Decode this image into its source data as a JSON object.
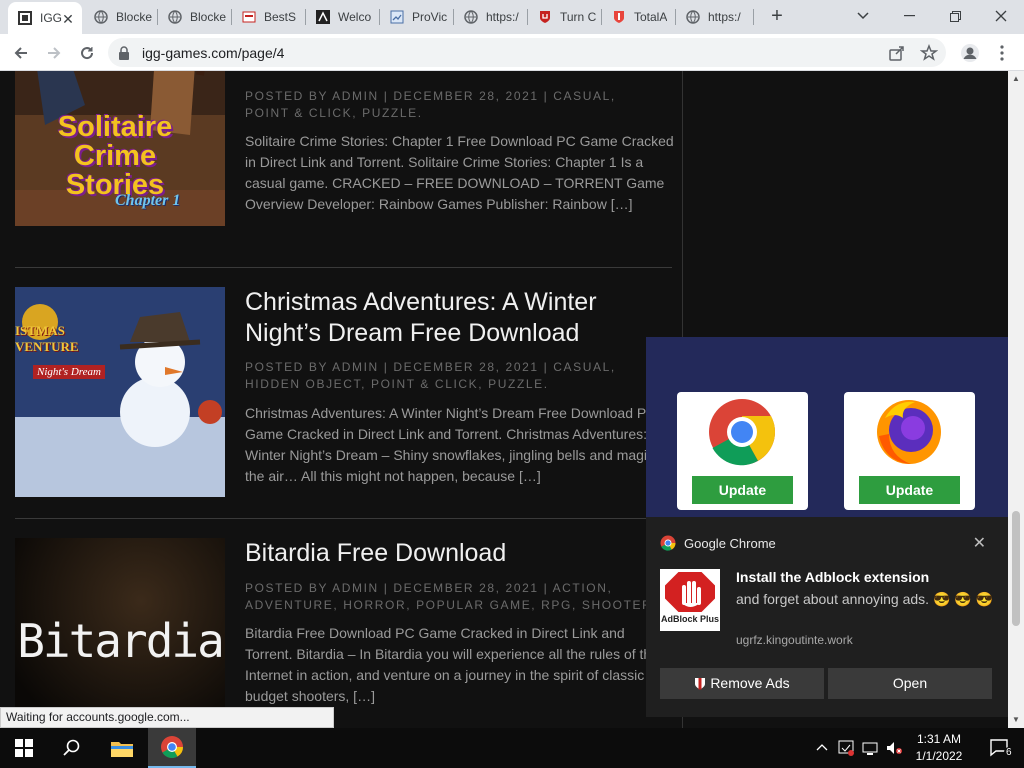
{
  "browser": {
    "tabs": [
      {
        "title": "IGG",
        "active": true
      },
      {
        "title": "Blocke"
      },
      {
        "title": "Blocke"
      },
      {
        "title": "BestS"
      },
      {
        "title": "Welco"
      },
      {
        "title": "ProVic"
      },
      {
        "title": "https:/"
      },
      {
        "title": "Turn C"
      },
      {
        "title": "TotalA"
      },
      {
        "title": "https:/"
      }
    ],
    "url": "igg-games.com/page/4",
    "status_text": "Waiting for accounts.google.com..."
  },
  "posts": [
    {
      "thumb_title": "Solitaire Crime Stories",
      "thumb_subtitle": "Chapter 1",
      "meta": "POSTED BY ADMIN | DECEMBER 28, 2021 | CASUAL, POINT & CLICK, PUZZLE.",
      "excerpt": "Solitaire Crime Stories: Chapter 1 Free Download PC Game Cracked in Direct Link and Torrent. Solitaire Crime Stories: Chapter 1 Is a casual game. CRACKED – FREE DOWNLOAD – TORRENT Game Overview   Developer: Rainbow Games Publisher: Rainbow […]"
    },
    {
      "title": "Christmas Adventures: A Winter Night’s Dream Free Download",
      "thumb_title": "ISTMAS VENTURE",
      "thumb_subtitle": "Night's Dream",
      "meta": "POSTED BY ADMIN | DECEMBER 28, 2021 | CASUAL, HIDDEN OBJECT, POINT & CLICK, PUZZLE.",
      "excerpt": "Christmas Adventures: A Winter Night’s Dream Free Download PC Game Cracked in Direct Link and Torrent. Christmas Adventures: A Winter Night’s Dream – Shiny snowflakes, jingling bells and magic in the air… All this might not happen, because […]"
    },
    {
      "title": "Bitardia Free Download",
      "thumb_title": "Bitardia",
      "meta": "POSTED BY ADMIN | DECEMBER 28, 2021 | ACTION, ADVENTURE, HORROR, POPULAR GAME, RPG, SHOOTER.",
      "excerpt": "Bitardia Free Download PC Game Cracked in Direct Link and Torrent. Bitardia – In Bitardia you will experience all the rules of the Internet in action, and venture on a journey in the spirit of classic low-budget shooters, […]"
    }
  ],
  "ad": {
    "chrome_button": "Update",
    "firefox_button": "Update"
  },
  "notification": {
    "app_name": "Google Chrome",
    "headline": "Install the Adblock extension",
    "body": "and forget about annoying ads.",
    "emojis": "😎 😎 😎",
    "icon_label": "AdBlock Plus",
    "source": "ugrfz.kingoutinte.work",
    "remove_button": "Remove Ads",
    "open_button": "Open"
  },
  "taskbar": {
    "time": "1:31 AM",
    "date": "1/1/2022",
    "notification_count": "6"
  }
}
